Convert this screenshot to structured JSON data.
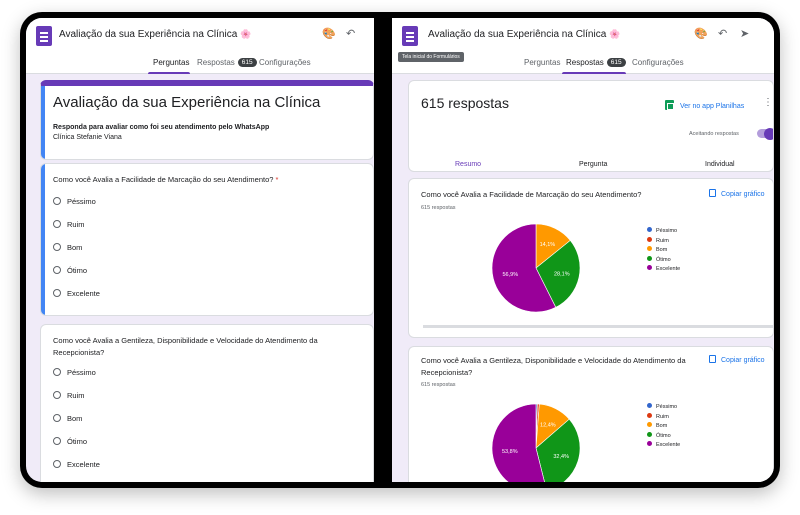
{
  "left": {
    "title": "Avaliação da sua Experiência na Clínica",
    "flower": "🌸",
    "tabs": {
      "perguntas": "Perguntas",
      "respostas": "Respostas",
      "badge": "615",
      "config": "Configurações"
    },
    "form_title": "Avaliação da sua Experiência na Clínica",
    "form_subtitle": "Responda para avaliar como foi seu atendimento pelo WhatsApp",
    "form_org": "Clínica Stefanie Viana",
    "q1": "Como você Avalia a Facilidade de Marcação do seu Atendimento?",
    "q1_req": "*",
    "q2": "Como você Avalia a Gentileza, Disponibilidade e Velocidade do Atendimento da Recepcionista?",
    "options": [
      "Péssimo",
      "Ruim",
      "Bom",
      "Ótimo",
      "Excelente"
    ]
  },
  "right": {
    "title": "Avaliação da sua Experiência na Clínica",
    "tooltip": "Tela inicial do Formulários",
    "tabs": {
      "perguntas": "Perguntas",
      "respostas": "Respostas",
      "badge": "615",
      "config": "Configurações"
    },
    "count": "615 respostas",
    "sheets": "Ver no app Planilhas",
    "accepting": "Aceitando respostas",
    "subtabs": [
      "Resumo",
      "Pergunta",
      "Individual"
    ],
    "copy": "Copiar gráfico",
    "legend": [
      "Péssimo",
      "Ruim",
      "Bom",
      "Ótimo",
      "Excelente"
    ],
    "colors": {
      "Péssimo": "#3366cc",
      "Ruim": "#dc3912",
      "Bom": "#ff9900",
      "Ótimo": "#109618",
      "Excelente": "#990099"
    }
  },
  "chart_data": [
    {
      "type": "pie",
      "title": "Como você Avalia a Facilidade de Marcação do seu Atendimento?",
      "subtitle": "615 respostas",
      "categories": [
        "Péssimo",
        "Ruim",
        "Bom",
        "Ótimo",
        "Excelente"
      ],
      "values": [
        0,
        0,
        14.1,
        28.1,
        56.9
      ],
      "labels": [
        "",
        "",
        "14,1%",
        "28,1%",
        "56,9%"
      ]
    },
    {
      "type": "pie",
      "title": "Como você Avalia a Gentileza, Disponibilidade e Velocidade do Atendimento da Recepcionista?",
      "subtitle": "615 respostas",
      "categories": [
        "Péssimo",
        "Ruim",
        "Bom",
        "Ótimo",
        "Excelente"
      ],
      "values": [
        0.5,
        0.7,
        12.4,
        32.4,
        53.8
      ],
      "labels": [
        "",
        "",
        "12,4%",
        "32,4%",
        "53,8%"
      ]
    }
  ]
}
